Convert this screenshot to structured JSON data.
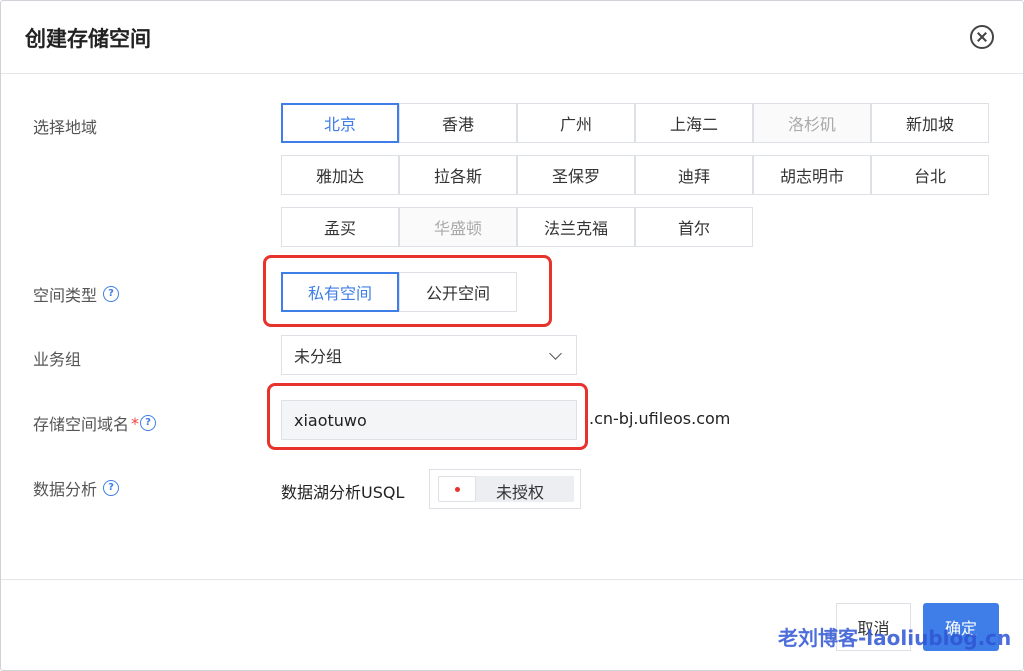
{
  "dialog": {
    "title": "创建存储空间"
  },
  "region": {
    "label": "选择地域",
    "options": [
      {
        "label": "北京",
        "state": "selected"
      },
      {
        "label": "香港",
        "state": "normal"
      },
      {
        "label": "广州",
        "state": "normal"
      },
      {
        "label": "上海二",
        "state": "normal"
      },
      {
        "label": "洛杉矶",
        "state": "disabled"
      },
      {
        "label": "新加坡",
        "state": "normal"
      },
      {
        "label": "雅加达",
        "state": "normal"
      },
      {
        "label": "拉各斯",
        "state": "normal"
      },
      {
        "label": "圣保罗",
        "state": "normal"
      },
      {
        "label": "迪拜",
        "state": "normal"
      },
      {
        "label": "胡志明市",
        "state": "normal"
      },
      {
        "label": "台北",
        "state": "normal"
      },
      {
        "label": "孟买",
        "state": "normal"
      },
      {
        "label": "华盛顿",
        "state": "disabled"
      },
      {
        "label": "法兰克福",
        "state": "normal"
      },
      {
        "label": "首尔",
        "state": "normal"
      }
    ]
  },
  "space_type": {
    "label": "空间类型",
    "options": [
      {
        "label": "私有空间",
        "state": "selected"
      },
      {
        "label": "公开空间",
        "state": "normal"
      }
    ]
  },
  "business_group": {
    "label": "业务组",
    "value": "未分组"
  },
  "domain": {
    "label": "存储空间域名",
    "required_mark": "*",
    "value": "xiaotuwo",
    "suffix": ".cn-bj.ufileos.com"
  },
  "analysis": {
    "label": "数据分析",
    "item_label": "数据湖分析USQL",
    "status": "未授权"
  },
  "footer": {
    "cancel": "取消",
    "confirm": "确定"
  },
  "watermark": "老刘博客-laoliublog.cn",
  "colors": {
    "accent": "#3f7ee8",
    "highlight": "#e8322c"
  }
}
